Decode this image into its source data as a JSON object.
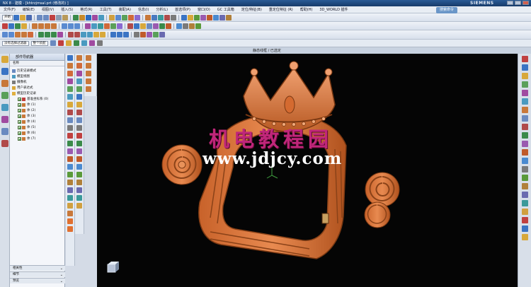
{
  "window": {
    "title": "NX 8 - 建模 - [khtrzjmsal.prt (修改的) ]",
    "brand": "SIEMENS"
  },
  "menu": {
    "items": [
      "文件(F)",
      "编辑(E)",
      "视图(V)",
      "插入(S)",
      "格式(R)",
      "工具(T)",
      "装配(A)",
      "信息(I)",
      "分析(L)",
      "首选项(P)",
      "窗口(O)",
      "GC 工具箱",
      "定位/特征(B)",
      "重定位特征 (R)",
      "帮助(H)",
      "3D_WORLD 插件"
    ],
    "help_button": "搜索命令"
  },
  "toolbar": {
    "start_label": "开始",
    "filter_label": "没有选择过滤器",
    "scope_label": "整个装配"
  },
  "viewport": {
    "status_text": "静态线框 / 已选定",
    "background": "#050505",
    "model_color": "#d8763a"
  },
  "navigator": {
    "header": "部件导航器",
    "column_name": "名称",
    "tree": [
      {
        "label": "历史记录模式",
        "icon": "history-icon",
        "indent": 0
      },
      {
        "label": "模型视图",
        "icon": "views-icon",
        "indent": 0
      },
      {
        "label": "摄像机",
        "icon": "camera-icon",
        "indent": 0
      },
      {
        "label": "用户表达式",
        "icon": "expression-icon",
        "indent": 0
      },
      {
        "label": "模型历史记录",
        "icon": "folder-icon",
        "indent": 0
      },
      {
        "label": "基准坐标系 (0)",
        "icon": "csys-icon",
        "indent": 1
      },
      {
        "label": "体 (1)",
        "icon": "body-icon",
        "indent": 1
      },
      {
        "label": "体 (2)",
        "icon": "body-icon",
        "indent": 1
      },
      {
        "label": "体 (3)",
        "icon": "body-icon",
        "indent": 1
      },
      {
        "label": "体 (4)",
        "icon": "body-icon",
        "indent": 1
      },
      {
        "label": "体 (5)",
        "icon": "body-icon",
        "indent": 1
      },
      {
        "label": "体 (6)",
        "icon": "body-icon",
        "indent": 1
      },
      {
        "label": "体 (7)",
        "icon": "body-icon",
        "indent": 1
      }
    ],
    "footer": [
      "相关性",
      "细节",
      "预览"
    ]
  },
  "watermark": {
    "chinese": "机电教程园",
    "url": "www.jdjcy.com"
  }
}
